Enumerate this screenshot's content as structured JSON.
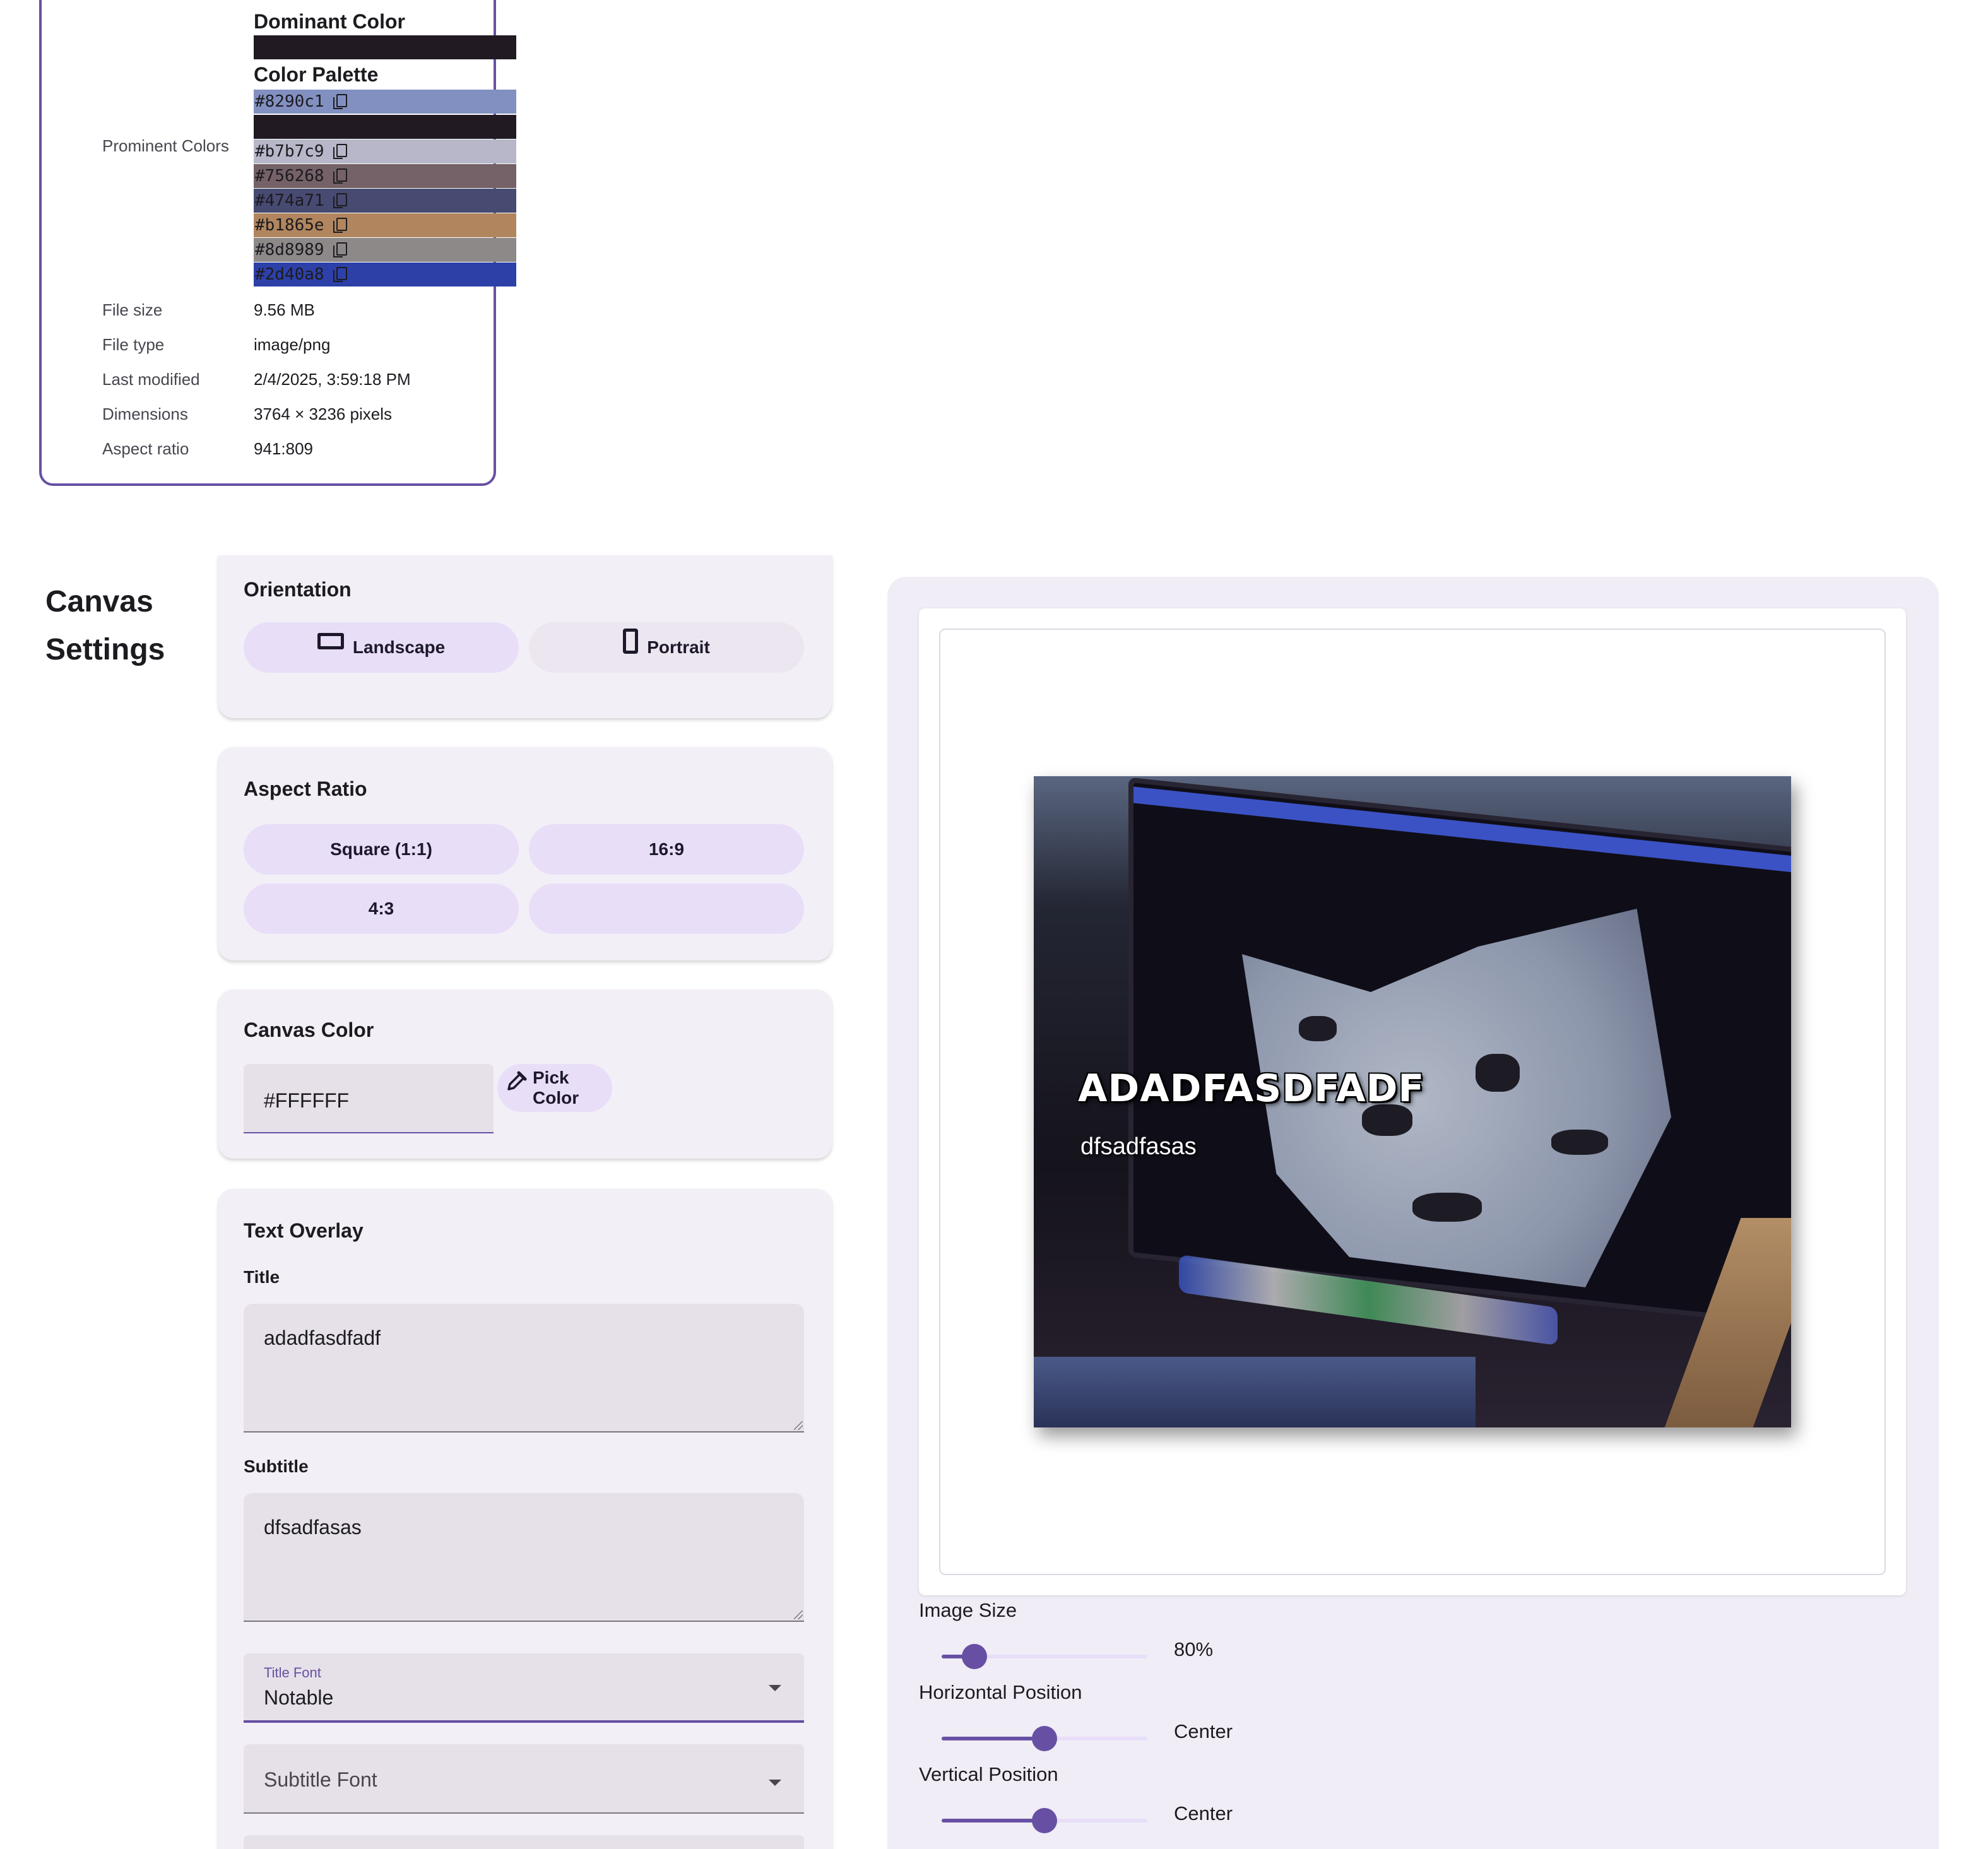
{
  "info": {
    "dominant_color_title": "Dominant Color",
    "dominant_color": "#211a22",
    "palette_title": "Color Palette",
    "prominent_colors_label": "Prominent Colors",
    "palette": [
      {
        "hex": "#8290c1",
        "label": "#8290c1"
      },
      {
        "hex": "#211a22",
        "label": ""
      },
      {
        "hex": "#b7b7c9",
        "label": "#b7b7c9"
      },
      {
        "hex": "#756268",
        "label": "#756268"
      },
      {
        "hex": "#474a71",
        "label": "#474a71"
      },
      {
        "hex": "#b1865e",
        "label": "#b1865e"
      },
      {
        "hex": "#8d8989",
        "label": "#8d8989"
      },
      {
        "hex": "#2d40a8",
        "label": "#2d40a8"
      }
    ],
    "rows": [
      {
        "label": "File size",
        "value": "9.56 MB"
      },
      {
        "label": "File type",
        "value": "image/png"
      },
      {
        "label": "Last modified",
        "value": "2/4/2025, 3:59:18 PM"
      },
      {
        "label": "Dimensions",
        "value": "3764 × 3236 pixels"
      },
      {
        "label": "Aspect ratio",
        "value": "941:809"
      }
    ]
  },
  "canvas_settings": {
    "heading_line1": "Canvas",
    "heading_line2": "Settings",
    "orientation": {
      "title": "Orientation",
      "landscape": "Landscape",
      "portrait": "Portrait",
      "landscape_icon": "landscape-icon",
      "portrait_icon": "portrait-icon"
    },
    "aspect_ratio": {
      "title": "Aspect Ratio",
      "options": [
        "Square (1:1)",
        "16:9",
        "4:3",
        ""
      ]
    },
    "canvas_color": {
      "title": "Canvas Color",
      "value": "#FFFFFF",
      "pick_label": "Pick Color",
      "pick_icon": "eyedropper-icon"
    },
    "text_overlay": {
      "title": "Text Overlay",
      "title_label": "Title",
      "title_value": "adadfasdfadf",
      "subtitle_label": "Subtitle",
      "subtitle_value": "dfsadfasas",
      "title_font_label": "Title Font",
      "title_font_value": "Notable",
      "subtitle_font_placeholder": "Subtitle Font"
    }
  },
  "preview": {
    "overlay_title": "ADADFASDFADF",
    "overlay_subtitle": "dfsadfasas",
    "image_size_label": "Image Size",
    "image_size_value": "80%",
    "image_size_level": 0.16,
    "horizontal_label": "Horizontal Position",
    "horizontal_value": "Center",
    "horizontal_level": 0.5,
    "vertical_label": "Vertical Position",
    "vertical_value": "Center",
    "vertical_level": 0.5
  },
  "colors": {
    "accent": "#6750a4",
    "panel_bg": "#f3eff7",
    "pill_bg": "#e8def8"
  }
}
